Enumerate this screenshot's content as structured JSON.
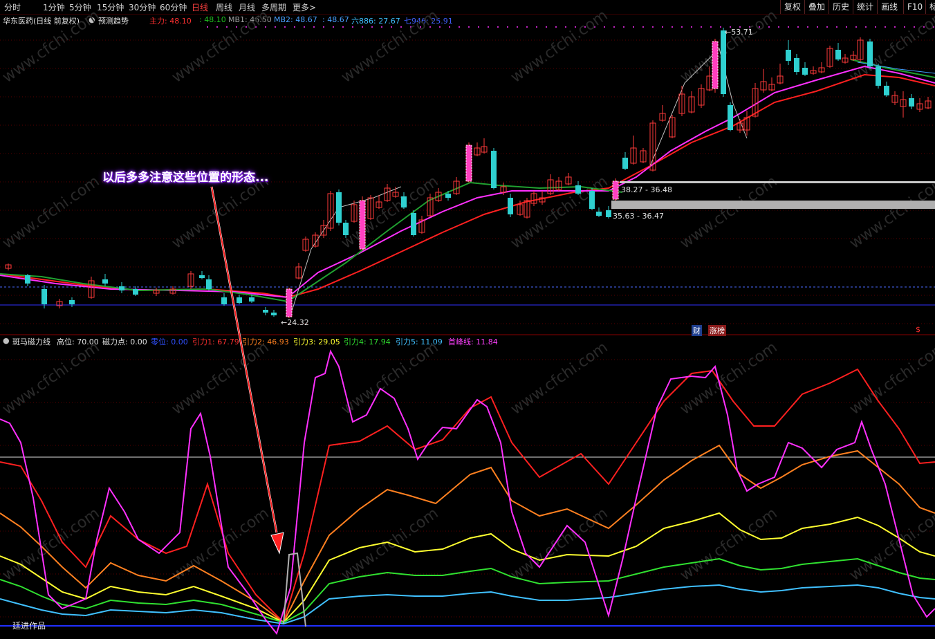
{
  "toolbar": {
    "tabs": [
      "分时",
      "1分钟",
      "5分钟",
      "15分钟",
      "30分钟",
      "60分钟",
      "日线",
      "周线",
      "月线",
      "多周期",
      "更多"
    ],
    "active_tab": "日线",
    "more_arrow": ">",
    "right_buttons": [
      "复权",
      "叠加",
      "历史",
      "统计",
      "画线",
      "F10",
      "标"
    ]
  },
  "main_info": {
    "stock_title": "华东医药(日线 前复权)",
    "trend_label": "预测趋势",
    "values": [
      {
        "text": "主力: 48.10",
        "color": "#ff3030"
      },
      {
        "text": ": 48.10",
        "color": "#20c020"
      },
      {
        "text": "MB1: 46.50",
        "color": "#a0a0a0"
      },
      {
        "text": "MB2: 48.67",
        "color": "#4aa0ff"
      },
      {
        "text": ": 48.67",
        "color": "#4aa0ff"
      },
      {
        "text": "六886: 27.67",
        "color": "#40c0ff"
      },
      {
        "text": "七946: 25.91",
        "color": "#4060ff"
      }
    ]
  },
  "price_labels": {
    "high": "53.71",
    "low": "24.32",
    "zone1": "38.27 - 36.48",
    "zone2": "35.63 - 36.47"
  },
  "badges": {
    "cai": "财",
    "zhangbang": "涨榜",
    "dollar": "$"
  },
  "annotation": "以后多多注意这些位置的形态...",
  "indicator_info": {
    "name": "斑马磁力线",
    "values": [
      {
        "text": "高位: 70.00",
        "color": "#e0e0e0"
      },
      {
        "text": "磁力点: 0.00",
        "color": "#e0e0e0"
      },
      {
        "text": "零位: 0.00",
        "color": "#3050ff"
      },
      {
        "text": "引力1: 67.79",
        "color": "#ff3030"
      },
      {
        "text": "引力2: 46.93",
        "color": "#ff8020"
      },
      {
        "text": "引力3: 29.05",
        "color": "#ffff30"
      },
      {
        "text": "引力4: 17.94",
        "color": "#30e030"
      },
      {
        "text": "引力5: 11.09",
        "color": "#40c0ff"
      },
      {
        "text": "首峰线: 11.84",
        "color": "#ff40ff"
      }
    ]
  },
  "credit": "廷进作品",
  "watermark": "www.cfchi.com",
  "colors": {
    "up": "#ff3a3a",
    "down": "#2fd0d0",
    "bg": "#000000"
  }
}
